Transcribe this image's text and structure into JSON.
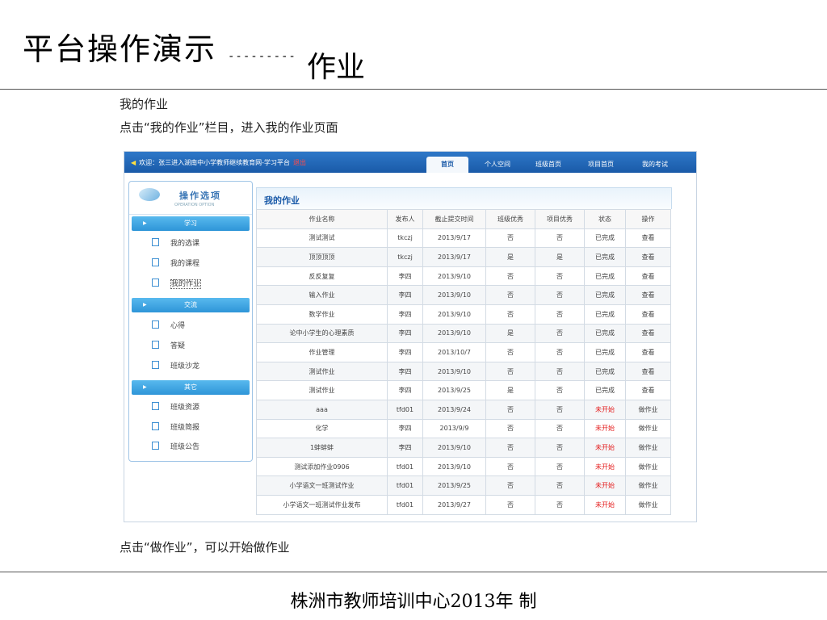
{
  "slide": {
    "title": "平台操作演示",
    "dashes": "---------",
    "subtitle": "作业",
    "para1": "我的作业",
    "para2": "点击“我的作业”栏目，进入我的作业页面",
    "para3": "点击“做作业”，可以开始做作业",
    "footer": "株洲市教师培训中心2013年 制"
  },
  "platform": {
    "welcome": "欢迎：张三进入湖南中小学教师继续教育网-学习平台",
    "logout": "退出",
    "nav": [
      "首页",
      "个人空间",
      "班级首页",
      "项目首页",
      "我的考试"
    ],
    "sidebar": {
      "header": "操作选项",
      "header_sub": "OPERATION OPTION",
      "sections": [
        {
          "title": "学习",
          "items": [
            "我的选课",
            "我的课程",
            "我的作业"
          ]
        },
        {
          "title": "交流",
          "items": [
            "心得",
            "答疑",
            "班级沙龙"
          ]
        },
        {
          "title": "其它",
          "items": [
            "班级资源",
            "班级简报",
            "班级公告"
          ]
        }
      ]
    },
    "main_title": "我的作业",
    "table": {
      "headers": [
        "作业名称",
        "发布人",
        "截止提交时间",
        "班级优秀",
        "项目优秀",
        "状态",
        "操作"
      ],
      "rows": [
        [
          "测试测试",
          "tkczj",
          "2013/9/17",
          "否",
          "否",
          "已完成",
          "查看"
        ],
        [
          "顶顶顶顶",
          "tkczj",
          "2013/9/17",
          "是",
          "是",
          "已完成",
          "查看"
        ],
        [
          "反反复复",
          "李四",
          "2013/9/10",
          "否",
          "否",
          "已完成",
          "查看"
        ],
        [
          "输入作业",
          "李四",
          "2013/9/10",
          "否",
          "否",
          "已完成",
          "查看"
        ],
        [
          "数学作业",
          "李四",
          "2013/9/10",
          "否",
          "否",
          "已完成",
          "查看"
        ],
        [
          "论中小学生的心理素质",
          "李四",
          "2013/9/10",
          "是",
          "否",
          "已完成",
          "查看"
        ],
        [
          "作业管理",
          "李四",
          "2013/10/7",
          "否",
          "否",
          "已完成",
          "查看"
        ],
        [
          "测试作业",
          "李四",
          "2013/9/10",
          "否",
          "否",
          "已完成",
          "查看"
        ],
        [
          "测试作业",
          "李四",
          "2013/9/25",
          "是",
          "否",
          "已完成",
          "查看"
        ],
        [
          "aaa",
          "tfd01",
          "2013/9/24",
          "否",
          "否",
          "未开始",
          "做作业"
        ],
        [
          "化学",
          "李四",
          "2013/9/9",
          "否",
          "否",
          "未开始",
          "做作业"
        ],
        [
          "1蚌蚌蚌",
          "李四",
          "2013/9/10",
          "否",
          "否",
          "未开始",
          "做作业"
        ],
        [
          "测试添加作业0906",
          "tfd01",
          "2013/9/10",
          "否",
          "否",
          "未开始",
          "做作业"
        ],
        [
          "小学语文一班测试作业",
          "tfd01",
          "2013/9/25",
          "否",
          "否",
          "未开始",
          "做作业"
        ],
        [
          "小学语文一班测试作业发布",
          "tfd01",
          "2013/9/27",
          "否",
          "否",
          "未开始",
          "做作业"
        ]
      ]
    }
  },
  "colors": {
    "topbar": "#1f64b4",
    "accent": "#2e95d8",
    "pending": "#e41b1b"
  }
}
